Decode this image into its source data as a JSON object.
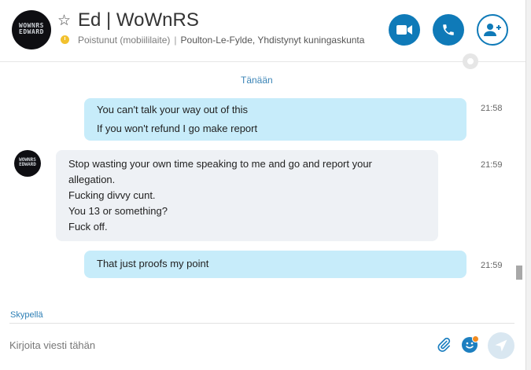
{
  "header": {
    "avatar_text_line1": "WOWNRS",
    "avatar_text_line2": "EDWARD",
    "title": "Ed | WoWnRS",
    "status": "Poistunut (mobiililaite)",
    "separator": "|",
    "location": "Poulton-Le-Fylde, Yhdistynyt kuningaskunta",
    "buttons": {
      "video": "video-call-icon",
      "call": "phone-icon",
      "add": "add-person-icon"
    }
  },
  "conversation": {
    "day_label": "Tänään",
    "messages": [
      {
        "direction": "out",
        "lines": [
          "You can't talk your way out of this",
          "If you won't refund I go make report"
        ],
        "time": "21:58"
      },
      {
        "direction": "in",
        "lines": [
          "Stop wasting your own time speaking to me and go and report your",
          "allegation.",
          "Fucking divvy cunt.",
          "You 13 or something?",
          "Fuck off."
        ],
        "time": "21:59"
      },
      {
        "direction": "out",
        "lines": [
          "That just proofs my point"
        ],
        "time": "21:59"
      }
    ]
  },
  "footer": {
    "skype_label": "Skypellä",
    "compose_placeholder": "Kirjoita viesti tähän"
  },
  "colors": {
    "accent": "#0f7ab8",
    "outgoing_bubble": "#c7ecfa",
    "incoming_bubble": "#eef1f5",
    "away": "#f2c12e"
  }
}
